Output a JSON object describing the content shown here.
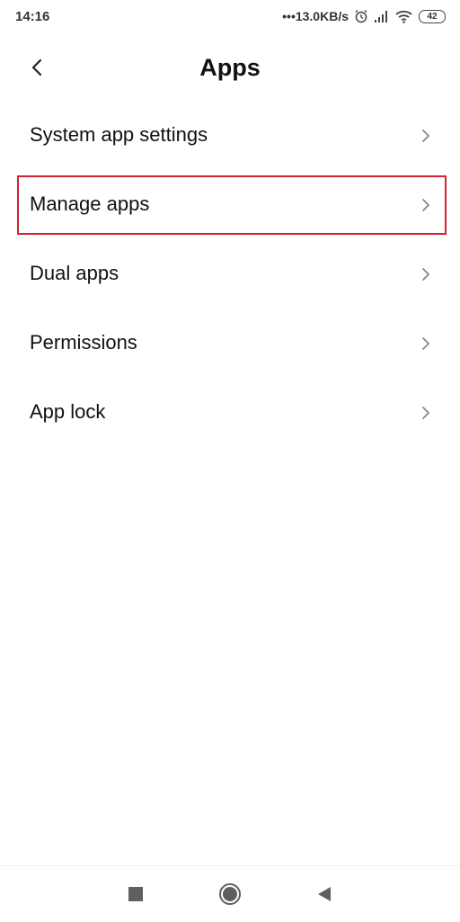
{
  "status_bar": {
    "time": "14:16",
    "network_speed": "•••13.0KB/s",
    "icons": [
      "alarm-icon",
      "signal-icon",
      "wifi-icon",
      "battery-icon"
    ],
    "battery_level": "42"
  },
  "header": {
    "back_icon": "chevron-left-icon",
    "title": "Apps"
  },
  "menu": {
    "items": [
      {
        "label": "System app settings",
        "icon": "chevron-right-icon"
      },
      {
        "label": "Manage apps",
        "icon": "chevron-right-icon",
        "highlighted": true
      },
      {
        "label": "Dual apps",
        "icon": "chevron-right-icon"
      },
      {
        "label": "Permissions",
        "icon": "chevron-right-icon"
      },
      {
        "label": "App lock",
        "icon": "chevron-right-icon"
      }
    ]
  },
  "highlight_color": "#d4222f",
  "nav_bar": {
    "buttons": [
      "recents-square-icon",
      "home-circle-icon",
      "back-triangle-icon"
    ]
  }
}
